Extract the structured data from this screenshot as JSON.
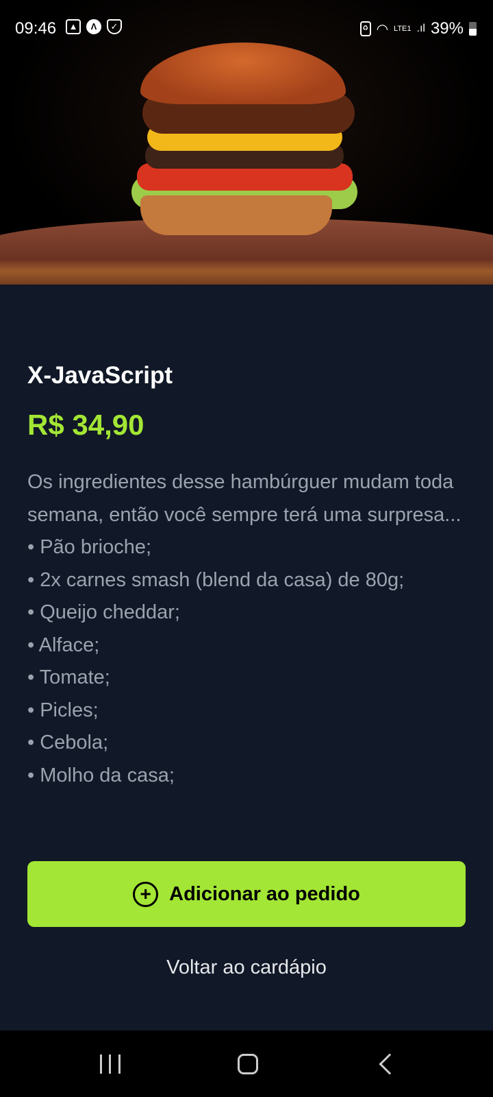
{
  "status_bar": {
    "time": "09:46",
    "battery": "39%",
    "network": "LTE1"
  },
  "product": {
    "name": "X-JavaScript",
    "price": "R$ 34,90",
    "description_lines": [
      "Os ingredientes desse hambúrguer mudam toda semana, então você sempre terá uma surpresa...",
      "• Pão brioche;",
      "• 2x carnes smash (blend da casa) de 80g;",
      "• Queijo cheddar;",
      "• Alface;",
      "• Tomate;",
      "• Picles;",
      "• Cebola;",
      "• Molho da casa;"
    ]
  },
  "actions": {
    "add_label": "Adicionar ao pedido",
    "add_icon": "plus-circle-icon",
    "back_label": "Voltar ao cardápio"
  },
  "colors": {
    "accent": "#a3e635",
    "background": "#111827"
  }
}
